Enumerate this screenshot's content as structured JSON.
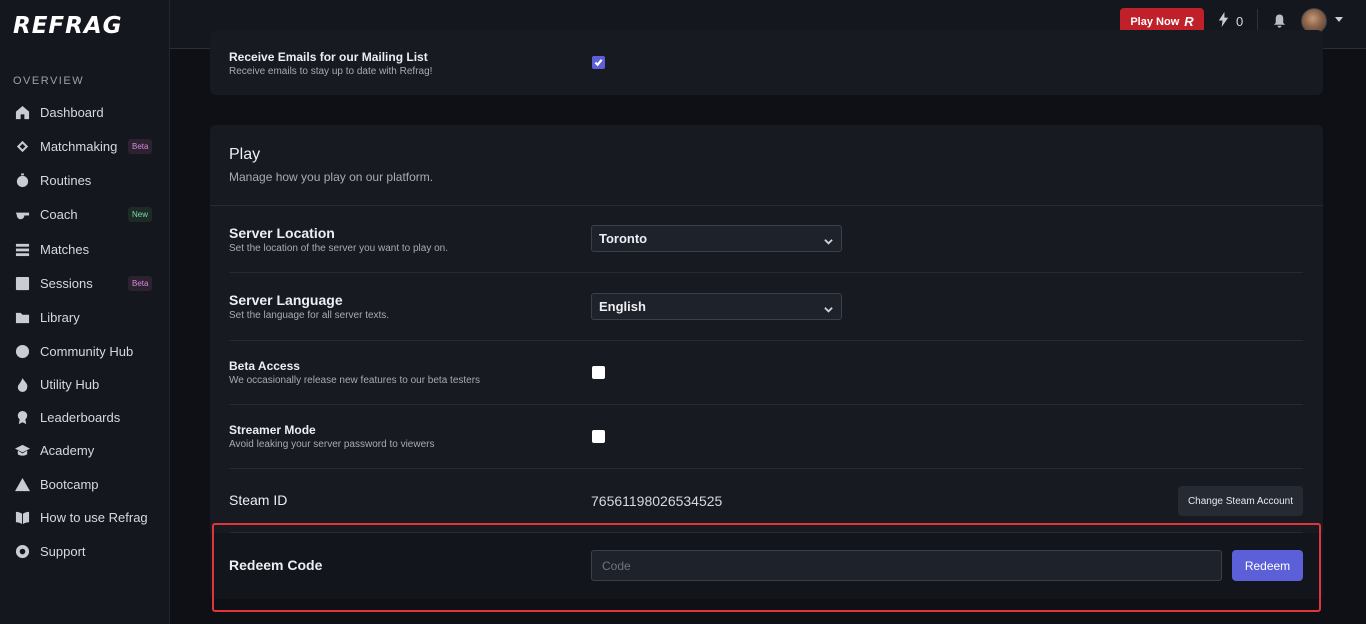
{
  "app": {
    "logo": "REFRAG"
  },
  "sidebar": {
    "section": "OVERVIEW",
    "items": [
      {
        "label": "Dashboard",
        "icon": "home-icon",
        "badge": ""
      },
      {
        "label": "Matchmaking",
        "icon": "crosshair-icon",
        "badge": "Beta"
      },
      {
        "label": "Routines",
        "icon": "stopwatch-icon",
        "badge": ""
      },
      {
        "label": "Coach",
        "icon": "whistle-icon",
        "badge": "New"
      },
      {
        "label": "Matches",
        "icon": "matches-icon",
        "badge": ""
      },
      {
        "label": "Sessions",
        "icon": "chart-icon",
        "badge": "Beta"
      },
      {
        "label": "Library",
        "icon": "folder-icon",
        "badge": ""
      },
      {
        "label": "Community Hub",
        "icon": "globe-icon",
        "badge": ""
      },
      {
        "label": "Utility Hub",
        "icon": "fire-icon",
        "badge": ""
      },
      {
        "label": "Leaderboards",
        "icon": "award-icon",
        "badge": ""
      },
      {
        "label": "Academy",
        "icon": "graduation-cap-icon",
        "badge": ""
      },
      {
        "label": "Bootcamp",
        "icon": "mountain-icon",
        "badge": ""
      },
      {
        "label": "How to use Refrag",
        "icon": "book-icon",
        "badge": ""
      },
      {
        "label": "Support",
        "icon": "lifebuoy-icon",
        "badge": ""
      }
    ]
  },
  "topbar": {
    "play_now": "Play Now",
    "play_now_mark": "R",
    "energy_count": "0"
  },
  "mailing": {
    "title": "Receive Emails for our Mailing List",
    "desc": "Receive emails to stay up to date with Refrag!",
    "checked": true
  },
  "play": {
    "title": "Play",
    "subtitle": "Manage how you play on our platform.",
    "server_location": {
      "title": "Server Location",
      "desc": "Set the location of the server you want to play on.",
      "value": "Toronto"
    },
    "server_language": {
      "title": "Server Language",
      "desc": "Set the language for all server texts.",
      "value": "English"
    },
    "beta_access": {
      "title": "Beta Access",
      "desc": "We occasionally release new features to our beta testers",
      "checked": false
    },
    "streamer_mode": {
      "title": "Streamer Mode",
      "desc": "Avoid leaking your server password to viewers",
      "checked": false
    },
    "steam": {
      "title": "Steam ID",
      "value": "76561198026534525",
      "button": "Change Steam Account"
    },
    "redeem": {
      "title": "Redeem Code",
      "placeholder": "Code",
      "button": "Redeem"
    }
  },
  "colors": {
    "accent": "#5c60d8",
    "play_red": "#c0202a",
    "highlight": "#e0353b"
  }
}
